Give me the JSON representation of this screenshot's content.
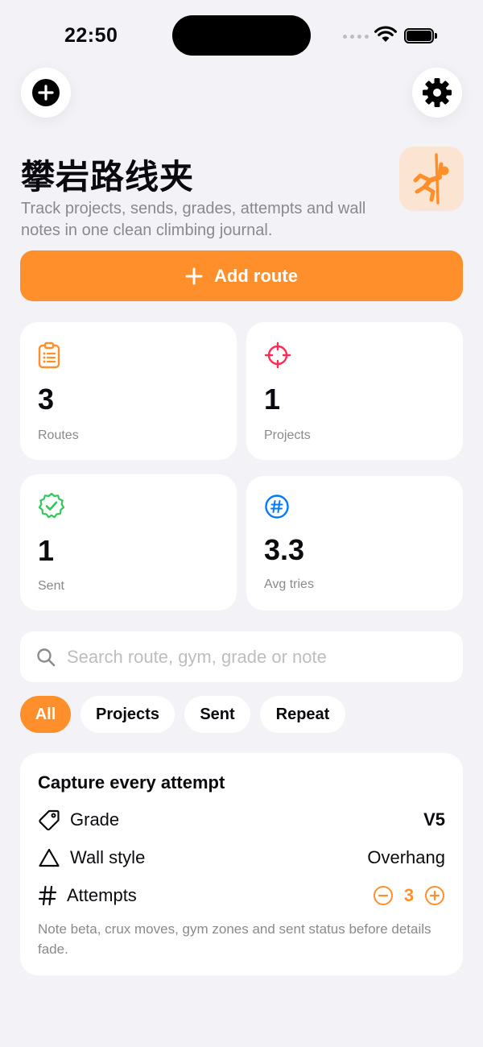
{
  "status_bar": {
    "time": "22:50"
  },
  "header": {
    "title": "攀岩路线夹",
    "subtitle": "Track projects, sends, grades, attempts and wall notes in one clean climbing journal.",
    "add_route_label": "Add route"
  },
  "stats": [
    {
      "value": "3",
      "label": "Routes",
      "icon": "clipboard-icon",
      "color": "#FF8F2B"
    },
    {
      "value": "1",
      "label": "Projects",
      "icon": "target-icon",
      "color": "#FF2D55"
    },
    {
      "value": "1",
      "label": "Sent",
      "icon": "checkmark-seal-icon",
      "color": "#34C759"
    },
    {
      "value": "3.3",
      "label": "Avg tries",
      "icon": "number-circle-icon",
      "color": "#007AFF"
    }
  ],
  "search": {
    "placeholder": "Search route, gym, grade or note",
    "value": ""
  },
  "filters": [
    {
      "label": "All",
      "active": true
    },
    {
      "label": "Projects",
      "active": false
    },
    {
      "label": "Sent",
      "active": false
    },
    {
      "label": "Repeat",
      "active": false
    }
  ],
  "capture": {
    "title": "Capture every attempt",
    "grade_label": "Grade",
    "grade_value": "V5",
    "wall_label": "Wall style",
    "wall_value": "Overhang",
    "attempts_label": "Attempts",
    "attempts_value": "3",
    "note": "Note beta, crux moves, gym zones and sent status before details fade."
  },
  "colors": {
    "accent": "#FF8F2B",
    "background": "#F2F2F7",
    "card": "#FFFFFF",
    "secondary_text": "#8A8A8E"
  }
}
